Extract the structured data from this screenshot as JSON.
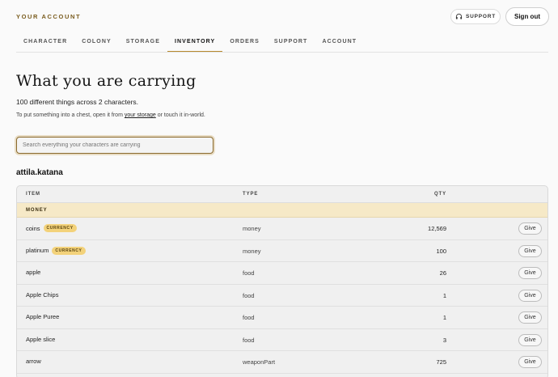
{
  "header": {
    "brand": "YOUR ACCOUNT",
    "support_label": "SUPPORT",
    "signout_label": "Sign out"
  },
  "nav": {
    "items": [
      "CHARACTER",
      "COLONY",
      "STORAGE",
      "INVENTORY",
      "ORDERS",
      "SUPPORT",
      "ACCOUNT"
    ],
    "active": "INVENTORY"
  },
  "page": {
    "title": "What you are carrying",
    "summary": "100 different things across 2 characters.",
    "hint_prefix": "To put something into a chest, open it from ",
    "hint_link": "your storage",
    "hint_suffix": " or touch it in-world.",
    "search_placeholder": "Search everything your characters are carrying"
  },
  "character": {
    "name": "attila.katana"
  },
  "table": {
    "columns": [
      "ITEM",
      "TYPE",
      "QTY"
    ],
    "section": "MONEY",
    "rows": [
      {
        "item": "coins",
        "badge": "CURRENCY",
        "type": "money",
        "qty": "12,569",
        "action": "Give"
      },
      {
        "item": "platinum",
        "badge": "CURRENCY",
        "type": "money",
        "qty": "100",
        "action": "Give"
      },
      {
        "item": "apple",
        "badge": "",
        "type": "food",
        "qty": "26",
        "action": "Give"
      },
      {
        "item": "Apple Chips",
        "badge": "",
        "type": "food",
        "qty": "1",
        "action": "Give"
      },
      {
        "item": "Apple Puree",
        "badge": "",
        "type": "food",
        "qty": "1",
        "action": "Give"
      },
      {
        "item": "Apple slice",
        "badge": "",
        "type": "food",
        "qty": "3",
        "action": "Give"
      },
      {
        "item": "arrow",
        "badge": "",
        "type": "weaponPart",
        "qty": "725",
        "action": "Give"
      }
    ]
  }
}
